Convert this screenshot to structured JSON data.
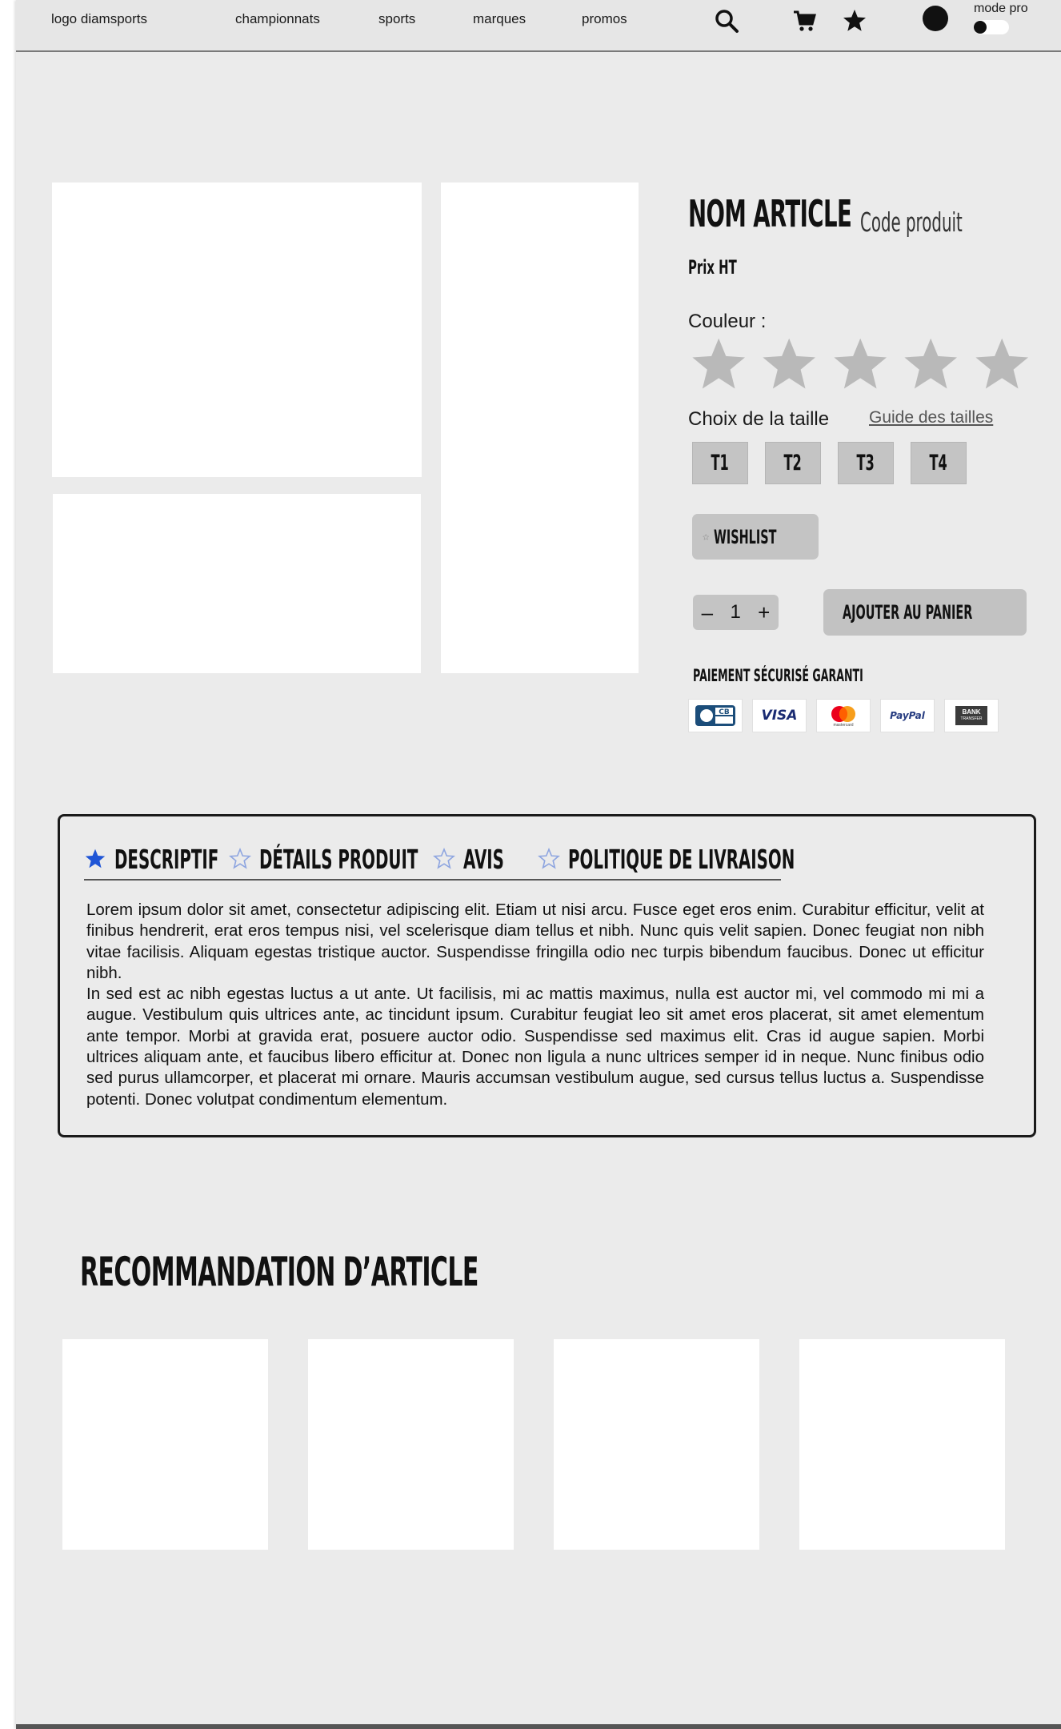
{
  "nav": {
    "logo": "logo diamsports",
    "links": [
      "championnats",
      "sports",
      "marques",
      "promos"
    ],
    "icons": [
      "search-icon",
      "cart-icon",
      "star-icon"
    ],
    "mode_pro_label": "mode pro"
  },
  "product": {
    "name": "NOM ARTICLE",
    "code": "Code produit",
    "price": "Prix HT",
    "colour_label": "Couleur :",
    "colour_swatch_count": 5,
    "size_label": "Choix de la taille",
    "size_guide": "Guide des tailles",
    "sizes": [
      "T1",
      "T2",
      "T3",
      "T4"
    ],
    "wishlist_label": "WISHLIST",
    "quantity": "1",
    "qty_minus": "–",
    "qty_plus": "+",
    "add_to_cart_label": "AJOUTER AU PANIER",
    "secure_payment": "PAIEMENT SÉCURISÉ GARANTI",
    "payment_methods": {
      "cb": "CB",
      "visa": "VISA",
      "mastercard": "mastercard",
      "paypal": "PayPal",
      "bank_line1": "BANK",
      "bank_line2": "TRANSFER"
    }
  },
  "tabs": {
    "items": [
      "DESCRIPTIF",
      "DÉTAILS PRODUIT",
      "AVIS",
      "POLITIQUE DE LIVRAISON"
    ],
    "active": 0,
    "paragraph_1": "Lorem ipsum dolor sit amet, consectetur adipiscing elit. Etiam ut nisi arcu. Fusce eget eros enim. Curabitur efficitur, velit at finibus hendrerit, erat eros tempus nisi, vel scelerisque diam tellus et nibh. Nunc quis velit sapien. Donec feugiat non nibh vitae facilisis. Aliquam egestas tristique auctor. Suspendisse fringilla odio nec turpis bibendum faucibus. Donec ut efficitur nibh.",
    "paragraph_2": "In sed est ac nibh egestas luctus a ut ante. Ut facilisis, mi ac mattis maximus, nulla est auctor mi, vel commodo mi mi a augue. Vestibulum quis ultrices ante, ac tincidunt ipsum. Curabitur feugiat leo sit amet eros placerat, sit amet elementum ante tempor. Morbi at gravida erat, posuere auctor odio. Suspendisse sed maximus elit. Cras id augue sapien. Morbi ultrices aliquam ante, et faucibus libero efficitur at. Donec non ligula a nunc ultrices semper id in neque. Nunc finibus odio sed purus ullamcorper, et placerat mi ornare. Mauris accumsan vestibulum augue, sed cursus tellus luctus a. Suspendisse potenti. Donec volutpat condimentum elementum."
  },
  "recommendations": {
    "title": "RECOMMANDATION D’ARTICLE",
    "card_count": 4
  },
  "colors": {
    "page_bg": "#ebebeb",
    "nav_bg": "#e6e6e6",
    "button_gray": "#c4c4c4",
    "swatch_gray": "#b9b9b9",
    "accent_blue": "#1f55d6",
    "tab_star_outline": "#8fa6e0"
  }
}
